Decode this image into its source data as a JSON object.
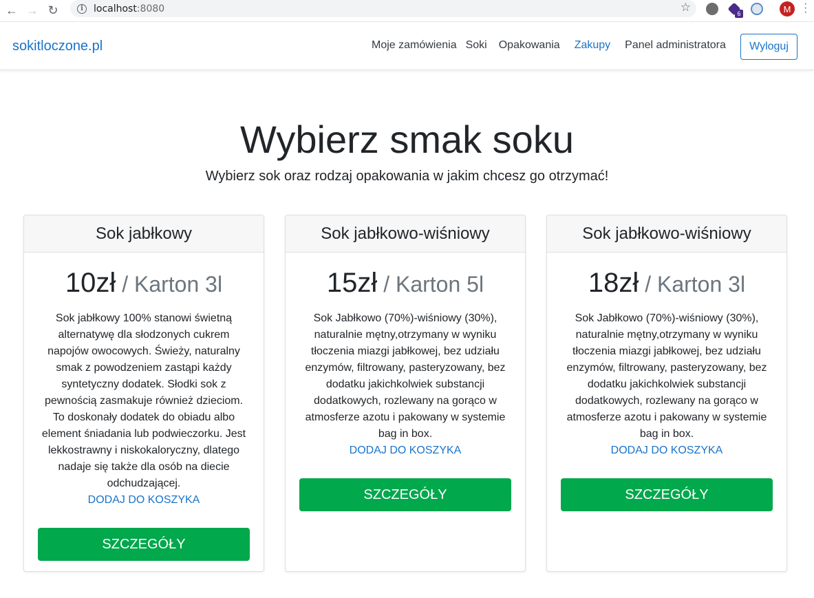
{
  "browser": {
    "url_host": "localhost",
    "url_port": ":8080",
    "extension_badge": "6",
    "profile_initial": "M"
  },
  "navbar": {
    "brand": "sokitloczone.pl",
    "links": [
      "Moje zamówienia",
      "Soki",
      "Opakowania",
      "Zakupy",
      "Panel administratora"
    ],
    "active_link": "Zakupy",
    "logout_label": "Wyloguj"
  },
  "hero": {
    "title": "Wybierz smak soku",
    "subtitle": "Wybierz sok oraz rodzaj opakowania w jakim chcesz go otrzymać!"
  },
  "cards": [
    {
      "title": "Sok jabłkowy",
      "price": "10zł",
      "unit": " / Karton 3l",
      "description_lines": [
        "Sok jabłkowy 100% stanowi świetną",
        "alternatywę dla słodzonych cukrem",
        "napojów owocowych. Świeży, naturalny",
        "smak z powodzeniem zastąpi każdy",
        "syntetyczny dodatek. Słodki sok z",
        "pewnością zasmakuje również dzieciom.",
        "To doskonały dodatek do obiadu albo",
        "element śniadania lub podwieczorku. Jest",
        "lekkostrawny i niskokaloryczny, dlatego",
        "nadaje się także dla osób na diecie",
        "odchudzającej."
      ],
      "add_to_cart": "DODAJ DO KOSZYKA",
      "details": "SZCZEGÓŁY"
    },
    {
      "title": "Sok jabłkowo-wiśniowy",
      "price": "15zł",
      "unit": " / Karton 5l",
      "description_lines": [
        "Sok Jabłkowo (70%)-wiśniowy (30%),",
        "naturalnie mętny,otrzymany w wyniku",
        "tłoczenia miazgi jabłkowej, bez udziału",
        "enzymów, filtrowany, pasteryzowany, bez",
        "dodatku jakichkolwiek substancji",
        "dodatkowych, rozlewany na gorąco w",
        "atmosferze azotu i pakowany w systemie",
        "bag in box."
      ],
      "add_to_cart": "DODAJ DO KOSZYKA",
      "details": "SZCZEGÓŁY"
    },
    {
      "title": "Sok jabłkowo-wiśniowy",
      "price": "18zł",
      "unit": " / Karton 3l",
      "description_lines": [
        "Sok Jabłkowo (70%)-wiśniowy (30%),",
        "naturalnie mętny,otrzymany w wyniku",
        "tłoczenia miazgi jabłkowej, bez udziału",
        "enzymów, filtrowany, pasteryzowany, bez",
        "dodatku jakichkolwiek substancji",
        "dodatkowych, rozlewany na gorąco w",
        "atmosferze azotu i pakowany w systemie",
        "bag in box."
      ],
      "add_to_cart": "DODAJ DO KOSZYKA",
      "details": "SZCZEGÓŁY"
    }
  ],
  "colors": {
    "link_blue": "#1a73c9",
    "button_green": "#02a84c"
  }
}
